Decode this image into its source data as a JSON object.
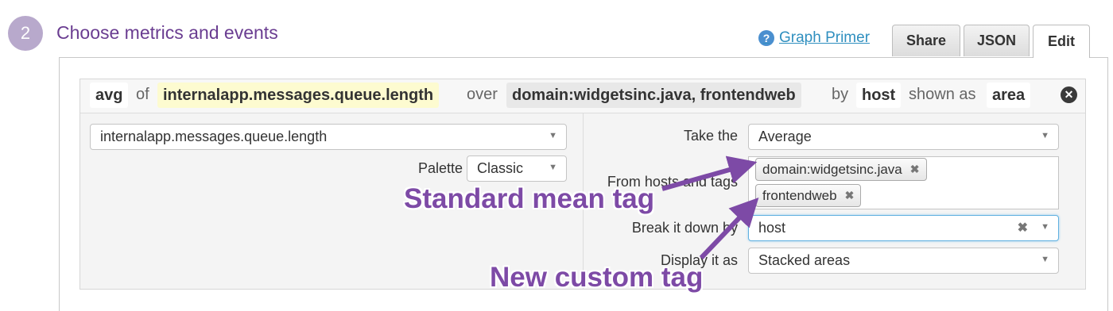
{
  "header": {
    "step_number": "2",
    "title": "Choose metrics and events",
    "help_icon": "question-circle-icon",
    "graph_primer": "Graph Primer"
  },
  "tabs": [
    {
      "label": "Share",
      "active": false
    },
    {
      "label": "JSON",
      "active": false
    },
    {
      "label": "Edit",
      "active": true
    }
  ],
  "summary": {
    "aggregation": "avg",
    "of_word": "of",
    "metric": "internalapp.messages.queue.length",
    "over_word": "over",
    "scope": "domain:widgetsinc.java, frontendweb",
    "by_word": "by",
    "group_by": "host",
    "shown_as_word": "shown as",
    "display": "area",
    "remove_icon": "close-circle-icon"
  },
  "left": {
    "metric_select": "internalapp.messages.queue.length",
    "palette_label": "Palette",
    "palette_value": "Classic"
  },
  "right": {
    "take_label": "Take the",
    "take_value": "Average",
    "from_label": "From hosts and tags",
    "tags": [
      "domain:widgetsinc.java",
      "frontendweb"
    ],
    "break_label": "Break it down by",
    "break_value": "host",
    "display_label": "Display it as",
    "display_value": "Stacked areas"
  },
  "annotations": {
    "standard": "Standard mean tag",
    "custom": "New custom tag",
    "color": "#7d4aa6"
  },
  "colors": {
    "title_purple": "#6a3d91",
    "link_blue": "#2f8fbf",
    "metric_highlight": "#fdfbd0"
  }
}
